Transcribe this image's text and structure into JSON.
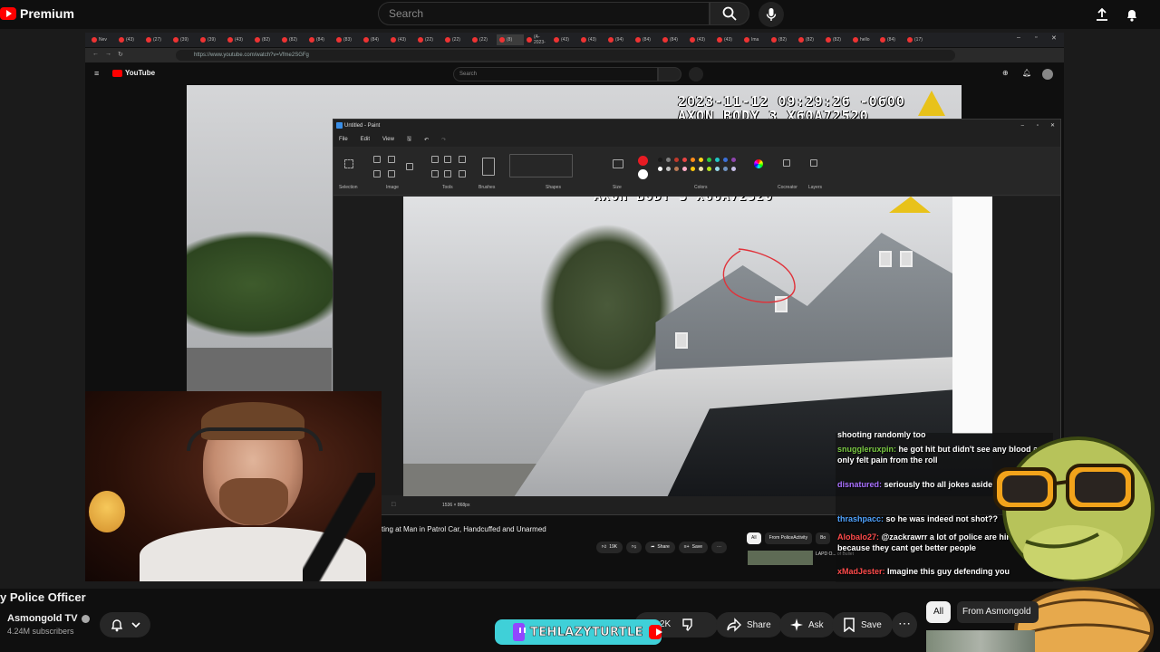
{
  "outer_header": {
    "brand": "Premium",
    "search_placeholder": "Search"
  },
  "inner_browser": {
    "url": "https://www.youtube.com/watch?v=Vfme2SGFg",
    "tabs": [
      "Nev",
      "(43)",
      "(27)",
      "(39)",
      "(39)",
      "(43)",
      "(82)",
      "(82)",
      "(84)",
      "(83)",
      "(84)",
      "(43)",
      "(22)",
      "(22)",
      "(22)",
      "(8)",
      "(A-2023-",
      "(43)",
      "(43)",
      "(94)",
      "(84)",
      "(84)",
      "(43)",
      "(43)",
      "Ima",
      "(82)",
      "(82)",
      "(82)",
      "hello",
      "(84)",
      "(17)"
    ],
    "youtube_brand": "YouTube",
    "search_placeholder": "Search"
  },
  "video": {
    "timestamp": "2023-11-12 09:29:26 -0600",
    "device": "AXON BODY 3 X60A72520",
    "title_fragment": "ting at Man in Patrol Car, Handcuffed and Unarmed",
    "likes": "19K",
    "share_label": "Share",
    "save_label": "Save",
    "related_chips": [
      "All",
      "From PoliceActivity",
      "Bo"
    ],
    "related_title": "LAPD O... of Bullet"
  },
  "paint": {
    "title": "Untitled - Paint",
    "menu": [
      "File",
      "Edit",
      "View"
    ],
    "groups": [
      "Selection",
      "Image",
      "Tools",
      "Brushes",
      "Shapes",
      "Size",
      "Colors",
      "Cocreator",
      "Layers"
    ],
    "canvas_stamp": "AXON BODY 3 X60A72520",
    "dimensions": "1536 × 868px",
    "colors": {
      "row1": [
        "#1a1a1a",
        "#7f7f7f",
        "#c0392b",
        "#e84343",
        "#ff8c1a",
        "#ffd21a",
        "#2ecc40",
        "#20c6c6",
        "#3a6fd8",
        "#8e44ad"
      ],
      "row2": [
        "#ffffff",
        "#c3c3c3",
        "#b97a57",
        "#ffaec9",
        "#ffc90e",
        "#efe4b0",
        "#b5e61d",
        "#99d9ea",
        "#7092be",
        "#c8bfe7"
      ],
      "primary": "#e81b23",
      "annotation": "#e0323a"
    }
  },
  "chat": [
    {
      "user": "",
      "color": "#ffffff",
      "text": "shooting randomly too"
    },
    {
      "user": "snuggleruxpin:",
      "color": "#7ac943",
      "text": "he got hit but didn't see any blood and only felt pain from the roll"
    },
    {
      "user": "disnatured:",
      "color": "#a970ff",
      "text": "seriously tho all jokes aside is okay"
    },
    {
      "user": "thrashpacc:",
      "color": "#4fa3ff",
      "text": "so he was indeed not shot??"
    },
    {
      "user": "Alobalo27:",
      "color": "#ff4b4b",
      "text": "@zackrawrr a lot of police are hired because they cant get better people"
    },
    {
      "user": "xMadJester:",
      "color": "#ff4b4b",
      "text": "Imagine this guy defending you"
    }
  ],
  "main_video": {
    "title": "y Police Officer",
    "channel": "Asmongold TV",
    "subscribers": "4.24M subscribers",
    "likes": "2K",
    "share": "Share",
    "ask": "Ask",
    "save": "Save",
    "chips": [
      "All",
      "From Asmongold"
    ]
  },
  "overlay": {
    "twitch_name": "TEHLAZYTURTLE"
  }
}
